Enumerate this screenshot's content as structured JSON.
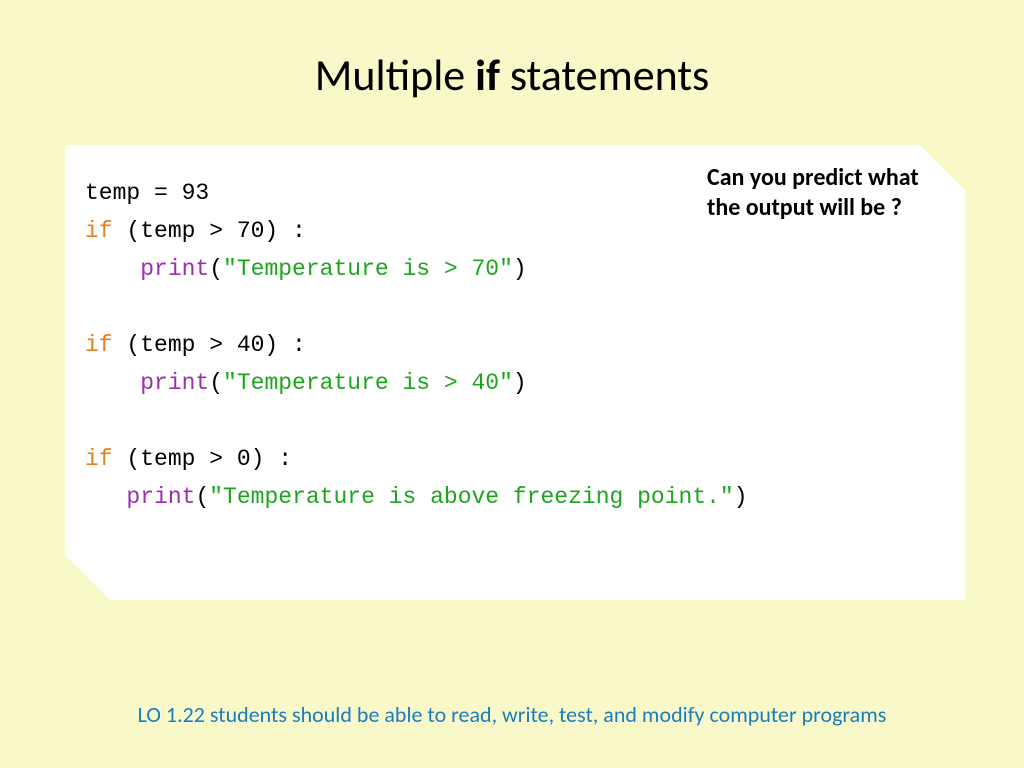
{
  "title_pre": "Multiple ",
  "title_bold": "if",
  "title_post": " statements",
  "question": "Can you predict what the output will be ?",
  "footer": "LO 1.22 students should be able to read, write, test, and modify computer programs",
  "code": {
    "l1_a": "temp = 93",
    "l2_kw": "if",
    "l2_b": " (temp > 70) :",
    "l3_indent": "    ",
    "l3_fn": "print",
    "l3_p1": "(",
    "l3_str": "\"Temperature is > 70\"",
    "l3_p2": ")",
    "l5_kw": "if",
    "l5_b": " (temp > 40) :",
    "l6_indent": "    ",
    "l6_fn": "print",
    "l6_p1": "(",
    "l6_str": "\"Temperature is > 40\"",
    "l6_p2": ")",
    "l8_kw": "if",
    "l8_b": " (temp > 0) :",
    "l9_indent": "   ",
    "l9_fn": "print",
    "l9_p1": "(",
    "l9_str": "\"Temperature is above freezing point.\"",
    "l9_p2": ")"
  }
}
